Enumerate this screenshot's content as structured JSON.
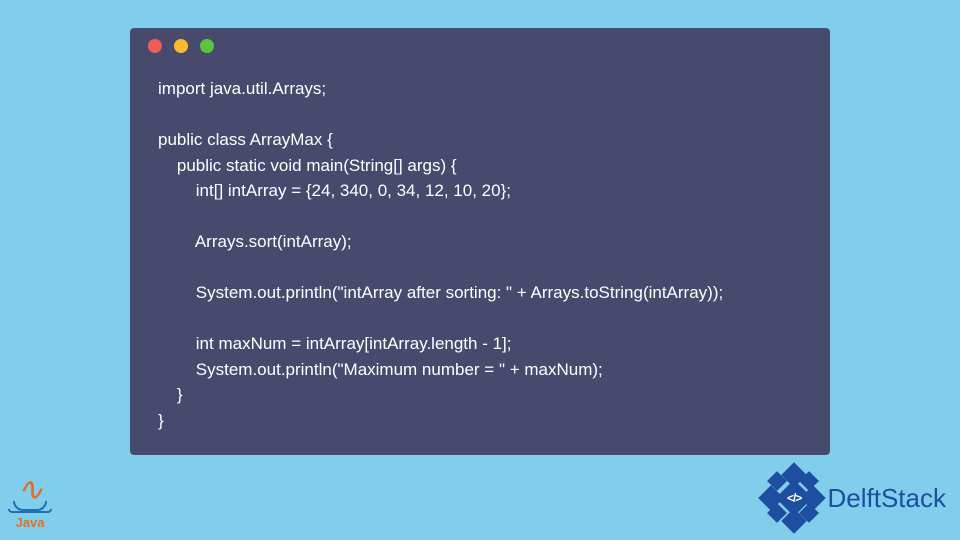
{
  "code": {
    "lines": [
      "import java.util.Arrays;",
      "",
      "public class ArrayMax {",
      "    public static void main(String[] args) {",
      "        int[] intArray = {24, 340, 0, 34, 12, 10, 20};",
      "",
      "        Arrays.sort(intArray);",
      "",
      "        System.out.println(\"intArray after sorting: \" + Arrays.toString(intArray));",
      "",
      "        int maxNum = intArray[intArray.length - 1];",
      "        System.out.println(\"Maximum number = \" + maxNum);",
      "    }",
      "}"
    ]
  },
  "logos": {
    "java_label": "Java",
    "delft_label": "DelftStack",
    "delft_badge_text": "</>"
  },
  "colors": {
    "page_bg": "#80cdec",
    "window_bg": "#474a6d",
    "code_text": "#ffffff",
    "dot_red": "#ee5e57",
    "dot_yellow": "#f6bb2f",
    "dot_green": "#5bc53c",
    "java_orange": "#e46e24",
    "java_blue": "#1f6fb5",
    "delft_blue": "#1d4e9f"
  }
}
